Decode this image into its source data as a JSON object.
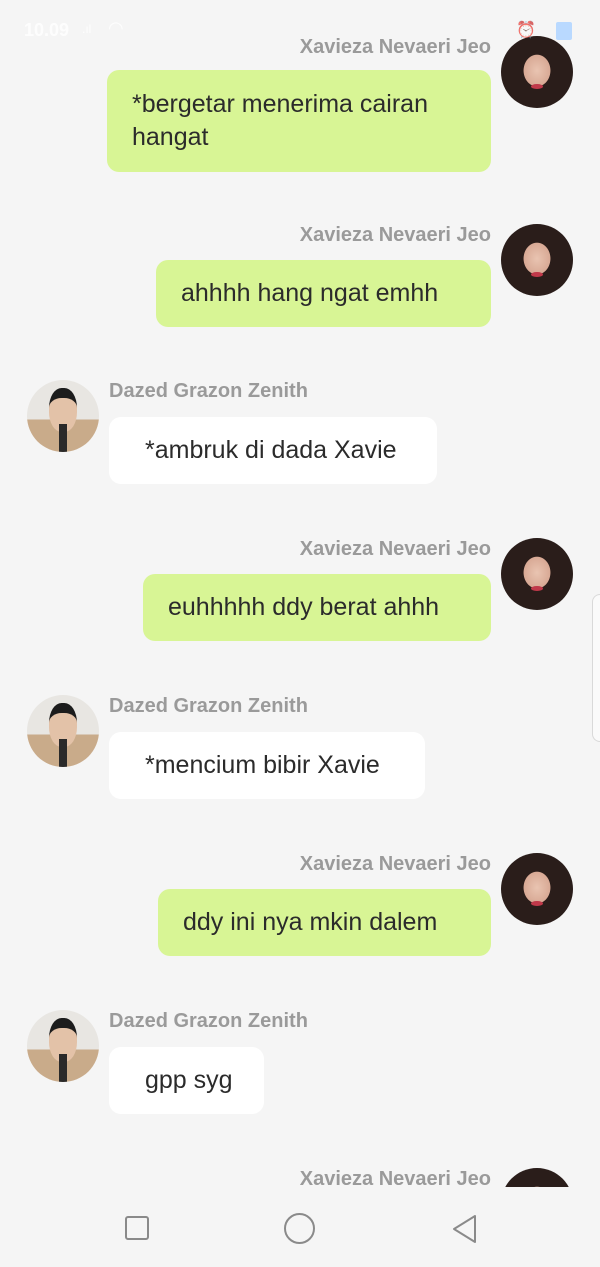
{
  "status_bar": {
    "time": "10.09",
    "signal": ".ıl",
    "wifi_icon": "wifi-icon",
    "alarm_icon": "alarm-icon",
    "battery_icon": "battery-icon"
  },
  "messages": [
    {
      "sender": "Xavieza Nevaeri Jeo",
      "side": "right",
      "avatar": "female-avatar",
      "lines": [
        "*bergetar menerima cairan",
        "hangat"
      ]
    },
    {
      "sender": "Xavieza Nevaeri Jeo",
      "side": "right",
      "avatar": "female-avatar",
      "lines": [
        "ahhhh hang ngat emhh"
      ]
    },
    {
      "sender": "Dazed Grazon Zenith",
      "side": "left",
      "avatar": "male-avatar",
      "lines": [
        "*ambruk di dada Xavie"
      ]
    },
    {
      "sender": "Xavieza Nevaeri Jeo",
      "side": "right",
      "avatar": "female-avatar",
      "lines": [
        "euhhhhh ddy berat ahhh"
      ]
    },
    {
      "sender": "Dazed Grazon Zenith",
      "side": "left",
      "avatar": "male-avatar",
      "lines": [
        "*mencium bibir Xavie"
      ]
    },
    {
      "sender": "Xavieza Nevaeri Jeo",
      "side": "right",
      "avatar": "female-avatar",
      "lines": [
        "ddy ini nya mkin dalem"
      ]
    },
    {
      "sender": "Dazed Grazon Zenith",
      "side": "left",
      "avatar": "male-avatar",
      "lines": [
        "gpp syg"
      ]
    },
    {
      "sender": "Xavieza Nevaeri Jeo",
      "side": "right",
      "avatar": "female-avatar",
      "lines": []
    }
  ],
  "nav_bar": {
    "recent_icon": "recent-apps-icon",
    "home_icon": "home-icon",
    "back_icon": "back-icon"
  },
  "colors": {
    "sent_bubble": "#d8f595",
    "received_bubble": "#ffffff",
    "background": "#f5f5f5",
    "sender_name": "#9a9a9a"
  }
}
